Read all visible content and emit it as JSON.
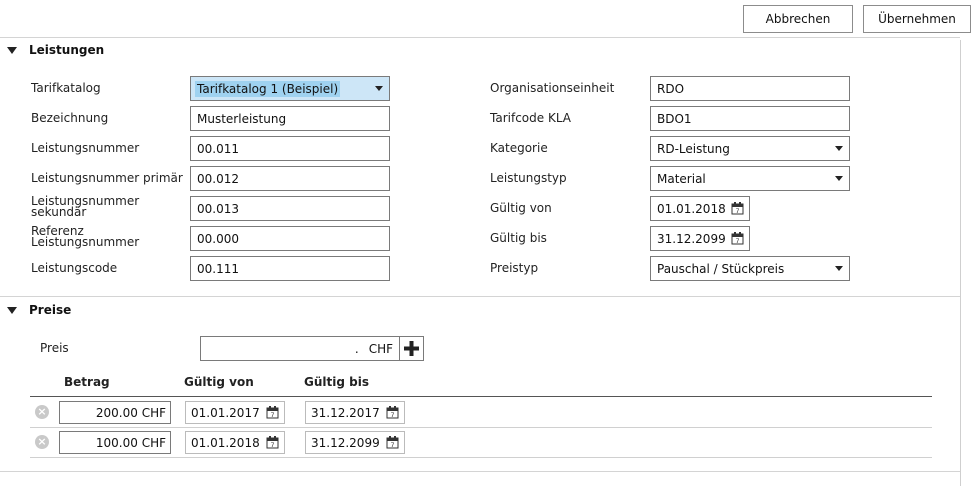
{
  "toolbar": {
    "cancel_label": "Abbrechen",
    "apply_label": "Übernehmen"
  },
  "leistungen": {
    "title": "Leistungen",
    "left": [
      {
        "label": "Tarifkatalog",
        "value": "Tarifkatalog 1 (Beispiel)"
      },
      {
        "label": "Bezeichnung",
        "value": "Musterleistung"
      },
      {
        "label": "Leistungsnummer",
        "value": "00.011"
      },
      {
        "label": "Leistungsnummer primär",
        "value": "00.012"
      },
      {
        "label": "Leistungsnummer sekundär",
        "value": "00.013"
      },
      {
        "label": "Referenz Leistungsnummer",
        "value": "00.000"
      },
      {
        "label": "Leistungscode",
        "value": "00.111"
      }
    ],
    "right": [
      {
        "label": "Organisationseinheit",
        "value": "RDO"
      },
      {
        "label": "Tarifcode KLA",
        "value": "BDO1"
      },
      {
        "label": "Kategorie",
        "value": "RD-Leistung"
      },
      {
        "label": "Leistungstyp",
        "value": "Material"
      },
      {
        "label": "Gültig von",
        "value": "01.01.2018"
      },
      {
        "label": "Gültig bis",
        "value": "31.12.2099"
      },
      {
        "label": "Preistyp",
        "value": "Pauschal / Stückpreis"
      }
    ]
  },
  "preise": {
    "title": "Preise",
    "preis_label": "Preis",
    "preis_value": ".",
    "currency": "CHF",
    "columns": [
      "Betrag",
      "Gültig von",
      "Gültig bis"
    ],
    "rows": [
      {
        "betrag": "200.00 CHF",
        "von": "01.01.2017",
        "bis": "31.12.2017"
      },
      {
        "betrag": "100.00 CHF",
        "von": "01.01.2018",
        "bis": "31.12.2099"
      }
    ]
  },
  "icons": {
    "collapse": "triangle-down-icon",
    "dropdown": "chevron-down-icon",
    "calendar": "calendar-icon",
    "add": "plus-icon",
    "remove": "remove-circle-icon"
  },
  "colors": {
    "selection": "#9fd2f0",
    "border": "#7a7a7a"
  }
}
